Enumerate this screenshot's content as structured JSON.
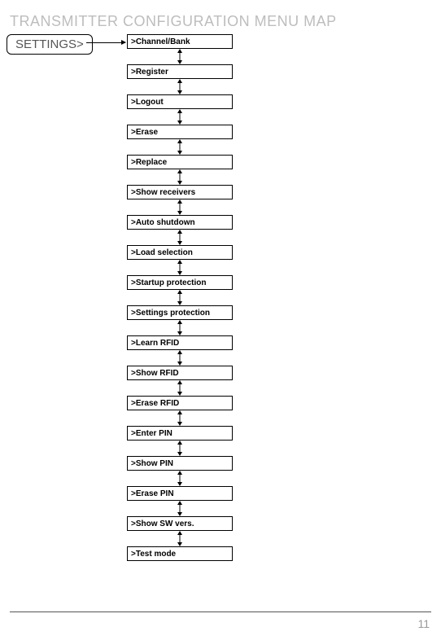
{
  "title": "TRANSMITTER CONFIGURATION MENU MAP",
  "settings_label": "SETTINGS>",
  "menu_items": [
    ">Channel/Bank",
    ">Register",
    ">Logout",
    ">Erase",
    ">Replace",
    ">Show receivers",
    ">Auto shutdown",
    ">Load selection",
    ">Startup protection",
    ">Settings protection",
    ">Learn RFID",
    ">Show RFID",
    ">Erase RFID",
    ">Enter PIN",
    ">Show PIN",
    ">Erase PIN",
    ">Show SW vers.",
    ">Test mode"
  ],
  "page_number": "11"
}
